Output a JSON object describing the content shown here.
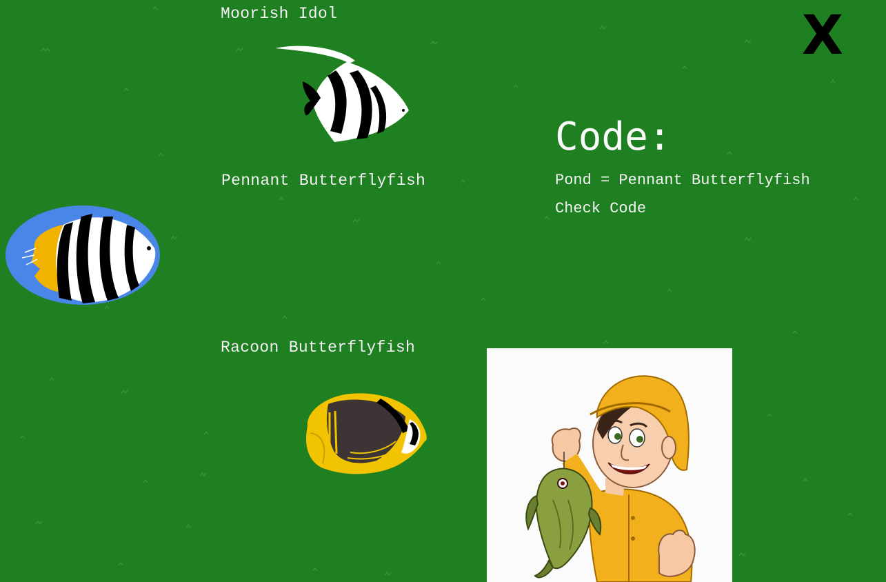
{
  "labels": {
    "moorish_idol": "Moorish Idol",
    "pennant_butterflyfish": "Pennant Butterflyfish",
    "racoon_butterflyfish": "Racoon Butterflyfish"
  },
  "code_panel": {
    "title": "Code:",
    "assignment": "Pond = Pennant Butterflyfish",
    "check_label": "Check Code"
  },
  "close": {
    "glyph": "X"
  },
  "icons": {
    "close": "close-x-icon",
    "moorish_idol": "moorish-idol-fish-icon",
    "pennant": "pennant-butterflyfish-icon",
    "racoon": "racoon-butterflyfish-icon",
    "fisherman": "fisherman-holding-fish-icon"
  },
  "colors": {
    "background": "#1e8020",
    "text": "#f4f4f4",
    "pond_blue": "#4a86e8",
    "fish_yellow": "#f2c300"
  }
}
